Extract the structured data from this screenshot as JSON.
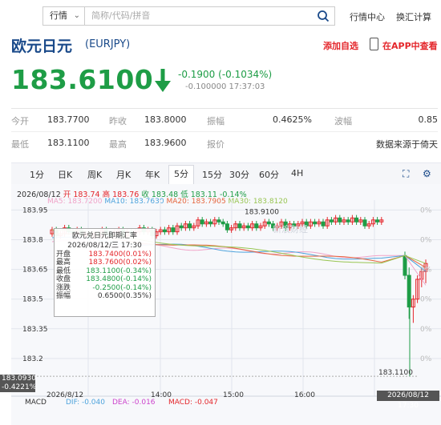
{
  "header": {
    "select_label": "行情",
    "search_placeholder": "简称/代码/拼音",
    "nav_quote_center": "行情中心",
    "nav_fx_calc": "换汇计算"
  },
  "title": {
    "name": "欧元日元",
    "code": "(EURJPY)",
    "add_favorite": "添加自选",
    "view_in_app": "在APP中查看"
  },
  "quote": {
    "price": "183.6100",
    "change": "-0.1900 (-0.1034%)",
    "sub": "-0.100000 17:37:03"
  },
  "stats": {
    "row1": [
      {
        "label": "今开",
        "value": "183.7700"
      },
      {
        "label": "昨收",
        "value": "183.8000"
      },
      {
        "label": "振幅",
        "value": "0.4625%"
      },
      {
        "label": "波幅",
        "value": "0.85"
      }
    ],
    "row2": [
      {
        "label": "最低",
        "value": "183.1100"
      },
      {
        "label": "最高",
        "value": "183.9600"
      },
      {
        "label": "报价",
        "value": "数据来源于倚天"
      }
    ]
  },
  "tabs": [
    "1分",
    "日K",
    "周K",
    "月K",
    "年K",
    "5分",
    "15分",
    "30分",
    "60分",
    "4H"
  ],
  "active_tab": "5分",
  "chart_info": {
    "date": "2026/08/12",
    "open": "开 183.74",
    "high": "高 183.76",
    "close": "收 183.48",
    "low": "低 183.11",
    "chg": "-0.14%",
    "ma5": "MA5: 183.7200",
    "ma10": "MA10: 183.7630",
    "ma20": "MA20: 183.7905",
    "ma30": "MA30: 183.8120",
    "high_marker": "183.9100",
    "low_marker": "183.1100",
    "watermark": "新浪财经",
    "y_ticks": [
      "183.95",
      "183.8",
      "183.65",
      "183.5",
      "183.35",
      "183.2"
    ],
    "right_pct": [
      "0%",
      "0%",
      "0%",
      "0%",
      "0%",
      "0%"
    ],
    "current_price_label": "183.0930",
    "current_pct_label": "-0.4221%",
    "cross_time": "2026/08/12 17:30",
    "x_labels": [
      "2026/8/12",
      "14:00",
      "15:00",
      "16:00"
    ]
  },
  "tooltip": {
    "title": "欧元兑日元即期汇率",
    "datetime": "2026/08/12/三 17:30",
    "rows": [
      {
        "k": "开盘",
        "v": "183.7400(0.01%)",
        "color": "#e4262b"
      },
      {
        "k": "最高",
        "v": "183.7600(0.02%)",
        "color": "#e4262b"
      },
      {
        "k": "最低",
        "v": "183.1100(-0.34%)",
        "color": "#1e9d46"
      },
      {
        "k": "收盘",
        "v": "183.4800(-0.14%)",
        "color": "#1e9d46"
      },
      {
        "k": "涨跌",
        "v": "-0.2500(-0.14%)",
        "color": "#1e9d46"
      },
      {
        "k": "振幅",
        "v": "0.6500(0.35%)",
        "color": "#333333"
      }
    ]
  },
  "macd": {
    "label": "MACD",
    "dif": "DIF: -0.040",
    "dea": "DEA: -0.016",
    "macd": "MACD: -0.047"
  },
  "colors": {
    "up": "#e4262b",
    "down": "#1e9d46",
    "brand": "#1a4a8a",
    "ma5": "#f0a3c8",
    "ma10": "#4ea3dc",
    "ma20": "#e5663e",
    "ma30": "#98c552"
  }
}
